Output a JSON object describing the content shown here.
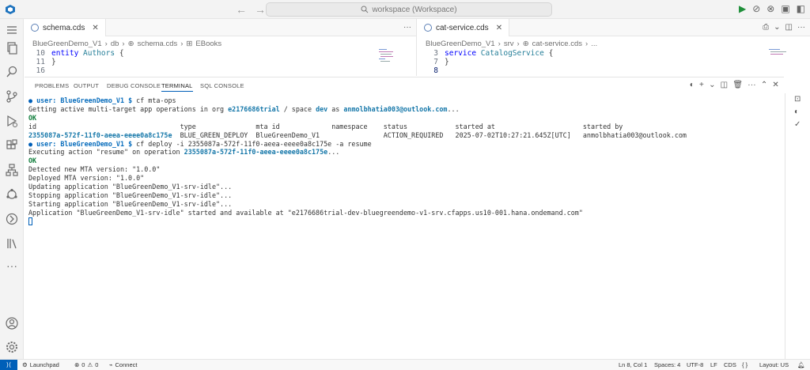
{
  "titlebar": {
    "search_label": "workspace (Workspace)",
    "back_icon": "arrow-left-icon",
    "forward_icon": "arrow-right-icon"
  },
  "editor_left": {
    "tab_label": "schema.cds",
    "breadcrumb": [
      "BlueGreenDemo_V1",
      "db",
      "schema.cds",
      "EBooks"
    ],
    "lines": [
      {
        "num": "10",
        "tokens": [
          {
            "t": "entity",
            "c": "kw"
          },
          {
            "t": " Authors",
            "c": "ident"
          },
          {
            "t": " {",
            "c": ""
          }
        ]
      },
      {
        "num": "11",
        "tokens": [
          {
            "t": "}",
            "c": ""
          }
        ]
      },
      {
        "num": "16",
        "tokens": []
      }
    ]
  },
  "editor_right": {
    "tab_label": "cat-service.cds",
    "breadcrumb": [
      "BlueGreenDemo_V1",
      "srv",
      "cat-service.cds",
      "..."
    ],
    "lines": [
      {
        "num": "3",
        "tokens": [
          {
            "t": "service",
            "c": "kw"
          },
          {
            "t": " CatalogService",
            "c": "ident"
          },
          {
            "t": " {",
            "c": ""
          }
        ]
      },
      {
        "num": "7",
        "tokens": [
          {
            "t": "}",
            "c": ""
          }
        ]
      },
      {
        "num": "8",
        "tokens": []
      }
    ]
  },
  "panel": {
    "tabs": [
      "PROBLEMS",
      "OUTPUT",
      "DEBUG CONSOLE",
      "TERMINAL",
      "SQL CONSOLE"
    ],
    "active_tab": "TERMINAL"
  },
  "terminal": {
    "prompt_user": "user: BlueGreenDemo_V1 $",
    "cmd1": " cf mta-ops",
    "line_getting_1": "Getting active multi-target app operations in org ",
    "org": "e2176686trial",
    "line_getting_2": " / space ",
    "space": "dev",
    "line_getting_3": " as ",
    "email": "anmolbhatia003@outlook.com",
    "line_getting_4": "...",
    "ok": "OK",
    "table_header": "id                                    type               mta id             namespace    status            started at                      started by",
    "table_row": "2355087a-572f-11f0-aeea-eeee0a8c175e  BLUE_GREEN_DEPLOY  BlueGreenDemo_V1                ACTION_REQUIRED   2025-07-02T10:27:21.645Z[UTC]   anmolbhatia003@outlook.com",
    "table_row_id": "2355087a-572f-11f0-aeea-eeee0a8c175e",
    "cmd2": " cf deploy -i 2355087a-572f-11f0-aeea-eeee0a8c175e -a resume",
    "executing_1": "Executing action \"resume\" on operation ",
    "executing_op": "2355087a-572f-11f0-aeea-eeee0a8c175e",
    "executing_2": "...",
    "lines_after": [
      "Detected new MTA version: \"1.0.0\"",
      "Deployed MTA version: \"1.0.0\"",
      "Updating application \"BlueGreenDemo_V1-srv-idle\"...",
      "Stopping application \"BlueGreenDemo_V1-srv-idle\"...",
      "Starting application \"BlueGreenDemo_V1-srv-idle\"...",
      "Application \"BlueGreenDemo_V1-srv-idle\" started and available at \"e2176686trial-dev-bluegreendemo-v1-srv.cfapps.us10-001.hana.ondemand.com\""
    ]
  },
  "statusbar": {
    "launchpad": "Launchpad",
    "errors": "0",
    "warnings": "0",
    "connect": "Connect",
    "position": "Ln 8, Col 1",
    "spaces": "Spaces: 4",
    "encoding": "UTF-8",
    "eol": "LF",
    "language": "CDS",
    "layout": "Layout: US"
  },
  "colors": {
    "accent": "#005fb8",
    "run_green": "#1f8f3a"
  }
}
